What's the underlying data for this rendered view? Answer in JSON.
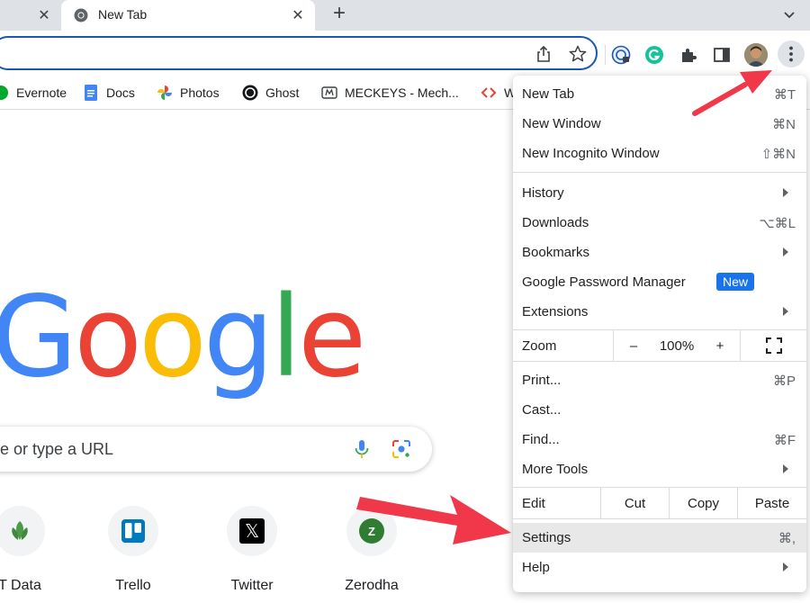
{
  "tabs": {
    "active_title": "New Tab",
    "close_glyph": "✕",
    "new_tab_glyph": "+"
  },
  "bookmarks": [
    {
      "label": "Evernote",
      "icon": "evernote-icon"
    },
    {
      "label": "Docs",
      "icon": "docs-icon"
    },
    {
      "label": "Photos",
      "icon": "photos-icon"
    },
    {
      "label": "Ghost",
      "icon": "ghost-icon"
    },
    {
      "label": "MECKEYS - Mech...",
      "icon": "meckeys-icon"
    },
    {
      "label": "W",
      "icon": "code-icon"
    }
  ],
  "google_logo": {
    "letters": [
      "G",
      "o",
      "o",
      "g",
      "l",
      "e"
    ]
  },
  "search": {
    "placeholder": "e or type a URL"
  },
  "shortcuts": [
    {
      "label": "T Data",
      "icon": "leaf-icon"
    },
    {
      "label": "Trello",
      "icon": "trello-icon"
    },
    {
      "label": "Twitter",
      "icon": "x-icon",
      "glyph": "𝕏"
    },
    {
      "label": "Zerodha",
      "icon": "zerodha-icon",
      "glyph": "Z"
    }
  ],
  "menu": {
    "new_tab": {
      "label": "New Tab",
      "shortcut": "⌘T"
    },
    "new_window": {
      "label": "New Window",
      "shortcut": "⌘N"
    },
    "new_incognito": {
      "label": "New Incognito Window",
      "shortcut": "⇧⌘N"
    },
    "history": {
      "label": "History"
    },
    "downloads": {
      "label": "Downloads",
      "shortcut": "⌥⌘L"
    },
    "bookmarks": {
      "label": "Bookmarks"
    },
    "password_manager": {
      "label": "Google Password Manager",
      "badge": "New"
    },
    "extensions": {
      "label": "Extensions"
    },
    "zoom": {
      "label": "Zoom",
      "minus": "–",
      "level": "100%",
      "plus": "+"
    },
    "print": {
      "label": "Print...",
      "shortcut": "⌘P"
    },
    "cast": {
      "label": "Cast..."
    },
    "find": {
      "label": "Find...",
      "shortcut": "⌘F"
    },
    "more_tools": {
      "label": "More Tools"
    },
    "edit": {
      "label": "Edit",
      "cut": "Cut",
      "copy": "Copy",
      "paste": "Paste"
    },
    "settings": {
      "label": "Settings",
      "shortcut": "⌘,"
    },
    "help": {
      "label": "Help"
    }
  },
  "colors": {
    "accent_blue": "#1a73e8",
    "annotation_red": "#f0384a",
    "omnibox_border": "#1a57b5"
  }
}
